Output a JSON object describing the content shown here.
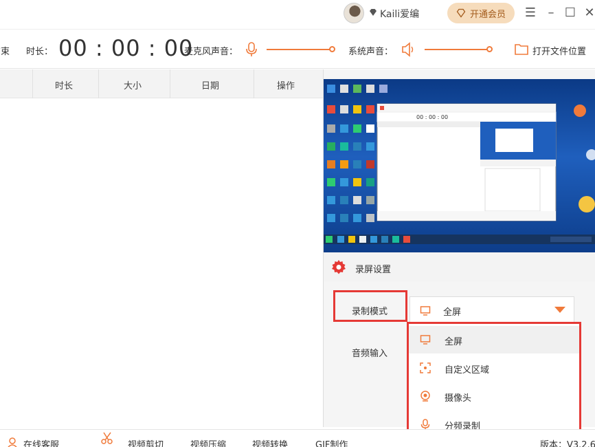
{
  "titlebar": {
    "username": "Kaili爱编",
    "vip_button": "开通会员"
  },
  "toolbar": {
    "end_label": "结束",
    "duration_label": "时长：",
    "timer": "00 : 00 : 00",
    "mic_label": "麦克风声音：",
    "system_label": "系统声音：",
    "open_folder": "打开文件位置"
  },
  "file_list": {
    "columns": [
      "时长",
      "大小",
      "日期",
      "操作"
    ]
  },
  "settings": {
    "title": "录屏设置",
    "record_mode_label": "录制模式",
    "audio_input_label": "音频输入",
    "selected_mode": "全屏",
    "mode_options": [
      "全屏",
      "自定义区域",
      "摄像头",
      "分频录制"
    ]
  },
  "bottombar": {
    "items": [
      "在线客服",
      "视频剪切",
      "视频压缩",
      "视频转换",
      "GIF制作"
    ],
    "version": "版本：V3.2.6"
  },
  "colors": {
    "accent": "#f07a3a",
    "highlight_box": "#e53935",
    "vip_bg": "#f6dcbc"
  }
}
